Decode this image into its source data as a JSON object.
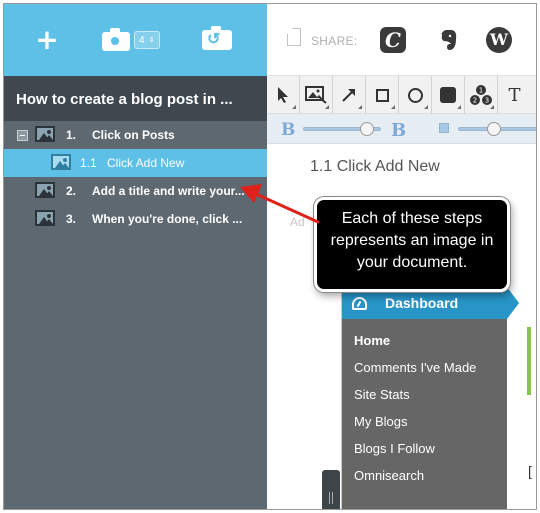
{
  "sidebar": {
    "image_count": "4",
    "document_title": "How to create a blog post in ...",
    "steps": [
      {
        "number": "1.",
        "label": "Click on Posts"
      },
      {
        "number": "1.1",
        "label": "Click Add New"
      },
      {
        "number": "2.",
        "label": "Add a title and write your..."
      },
      {
        "number": "3.",
        "label": "When you're done, click ..."
      }
    ]
  },
  "share": {
    "label": "SHARE:",
    "services": [
      "clippings-icon",
      "evernote-icon",
      "wordpress-icon"
    ]
  },
  "editor": {
    "step_heading": "1.1  Click Add New",
    "ghost_text": "Ad"
  },
  "dashboard": {
    "title": "Dashboard",
    "menu": [
      "Home",
      "Comments I've Made",
      "Site Stats",
      "My Blogs",
      "Blogs I Follow",
      "Omnisearch"
    ]
  },
  "callout": {
    "text": "Each of these steps represents an image in your document."
  },
  "colors": {
    "accent": "#5ec0e6",
    "sidebar": "#5d6870",
    "dashboard_blue": "#2795c6",
    "arrow": "#e0201b"
  }
}
